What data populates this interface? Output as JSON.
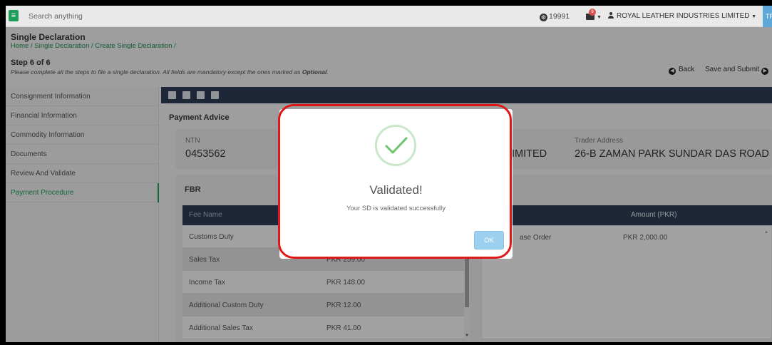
{
  "topbar": {
    "menu_icon": "hamburger-icon",
    "search_placeholder": "Search anything",
    "balance": "19991",
    "mail_badge": "9",
    "company": "ROYAL LEATHER INDUSTRIES LIMITED",
    "lang": "TR"
  },
  "header": {
    "title": "Single Declaration",
    "breadcrumb": "Home / Single Declaration / Create Single Declaration /",
    "step": "Step 6 of 6",
    "desc": "Please complete all the steps to file a single declaration. All fields are mandatory except the ones marked as ",
    "desc_bold": "Optional",
    "desc_end": ".",
    "back_label": "Back",
    "save_label": "Save and Submit"
  },
  "sidebar": {
    "items": [
      {
        "label": "Consignment Information"
      },
      {
        "label": "Financial Information"
      },
      {
        "label": "Commodity Information"
      },
      {
        "label": "Documents"
      },
      {
        "label": "Review And Validate"
      },
      {
        "label": "Payment Procedure"
      }
    ],
    "active_index": 5
  },
  "main": {
    "section_title": "Payment Advice",
    "ntn_label": "NTN",
    "ntn_value": "0453562",
    "trader_name_tail": "IMITED",
    "address_label": "Trader Address",
    "address_value": "26-B ZAMAN PARK SUNDAR DAS ROAD",
    "fbr_title": "FBR",
    "fee_header": "Fee Name",
    "fees": [
      {
        "name": "Customs Duty",
        "amount": ""
      },
      {
        "name": "Sales Tax",
        "amount": "PKR 259.00"
      },
      {
        "name": "Income Tax",
        "amount": "PKR 148.00"
      },
      {
        "name": "Additional Custom Duty",
        "amount": "PKR 12.00"
      },
      {
        "name": "Additional Sales Tax",
        "amount": "PKR 41.00"
      }
    ],
    "right_header": "Amount (PKR)",
    "right_row_name": "ase Order",
    "right_row_amount": "PKR 2,000.00"
  },
  "modal": {
    "title": "Validated!",
    "text": "Your SD is validated successfully",
    "ok_label": "OK",
    "icon": "success-check-icon"
  },
  "colors": {
    "accent_green": "#1e9e5a",
    "navy": "#2f3d55",
    "highlight_red": "#e01717",
    "ok_blue": "#9dd0ef"
  }
}
